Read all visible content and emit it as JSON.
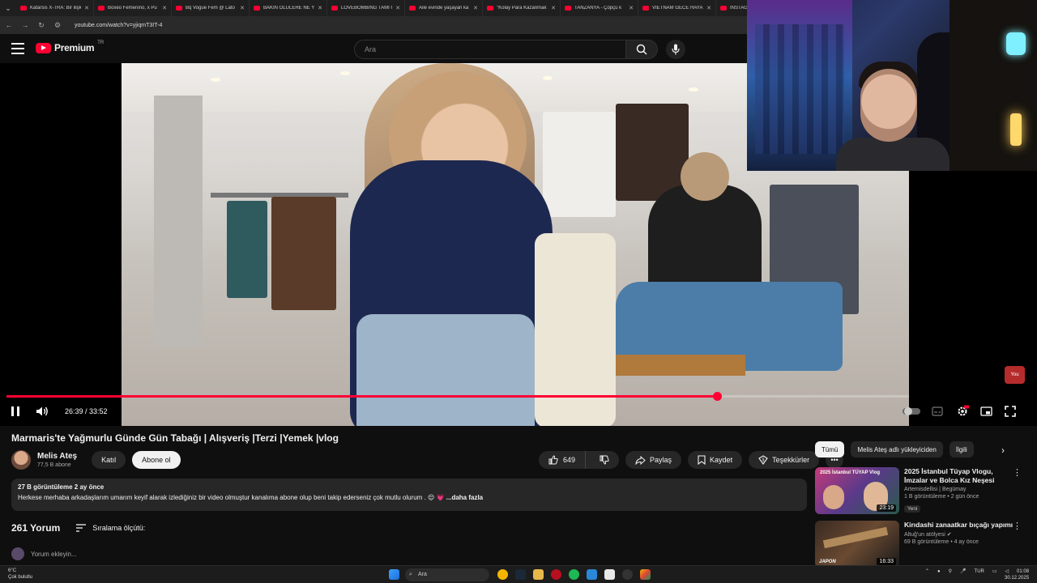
{
  "browser": {
    "tabs": [
      "Katarsis X-TRA: Bir ilişk",
      "Boxeo Femenino, x Pu",
      "Bq Vogue Fem @ Lato",
      "BAKIN ÖLÜLERE NE Y",
      "LOVEBOMBİNG TAMI C",
      "Aile evinde yaşayan ka",
      "\"Kolay Para Kazanmak",
      "TANZANYA - Çöpçü k",
      "VİETNAM GECE HAYAT",
      "INSTAGR"
    ],
    "url": "youtube.com/watch?v=yjiqmT3IT-4"
  },
  "youtube": {
    "logo_text": "Premium",
    "country": "TR",
    "search_placeholder": "Ara"
  },
  "player": {
    "time": "26:39 / 33:52",
    "progress": 0.787,
    "yt_badge": "You"
  },
  "video": {
    "title": "Marmaris'te Yağmurlu Günde Gün Tabağı | Alışveriş |Terzi |Yemek |vlog",
    "channel": "Melis Ateş",
    "subscribers": "77,5 B abone",
    "join_label": "Katıl",
    "subscribe_label": "Abone ol",
    "likes": "649",
    "share_label": "Paylaş",
    "save_label": "Kaydet",
    "thanks_label": "Teşekkürler",
    "views_date": "27 B görüntüleme  2 ay önce",
    "description": "Herkese merhaba arkadaşlarım umarım keyif alarak izlediğiniz bir video olmuştur kanalıma abone olup beni takip ederseniz çok mutlu olurum . 😌 💗",
    "more_label": "...daha fazla"
  },
  "comments": {
    "count": "261 Yorum",
    "sort_label": "Sıralama ölçütü:",
    "add_placeholder": "Yorum ekleyin..."
  },
  "sidebar": {
    "chips": [
      "Tümü",
      "Melis Ateş adlı yükleyiciden",
      "İlgili"
    ],
    "items": [
      {
        "title": "2025 İstanbul Tüyap Vlogu, İmzalar ve Bolca Kız Neşesi",
        "channel": "Artemisdellisi | Begümay",
        "meta": "1 B görüntüleme • 2 gün önce",
        "badge": "Yeni",
        "duration": "23:19",
        "thumb_text": "2025 İstanbul TÜYAP Vlog"
      },
      {
        "title": "Kirıdashi zanaatkar bıçağı yapımı",
        "channel": "Altuğ'un atölyesi",
        "meta": "69 B görüntüleme • 4 ay önce",
        "badge": "",
        "duration": "16:33",
        "thumb_text": "JAPON"
      }
    ]
  },
  "taskbar": {
    "weather_temp": "6°C",
    "weather_desc": "Çok bulutlu",
    "search_label": "Ara",
    "lang": "TUR",
    "time": "01:08",
    "date": "30.12.2025"
  },
  "colors": {
    "accent": "#ff0033",
    "bg": "#0f0f0f",
    "pill": "#272727"
  }
}
